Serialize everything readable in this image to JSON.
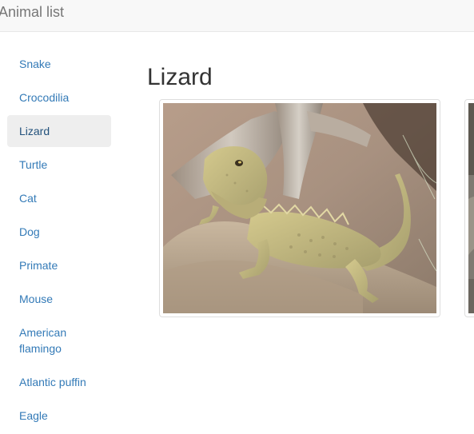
{
  "app": {
    "brand": "Animal list"
  },
  "sidebar": {
    "items": [
      {
        "label": "Snake",
        "active": false
      },
      {
        "label": "Crocodilia",
        "active": false
      },
      {
        "label": "Lizard",
        "active": true
      },
      {
        "label": "Turtle",
        "active": false
      },
      {
        "label": "Cat",
        "active": false
      },
      {
        "label": "Dog",
        "active": false
      },
      {
        "label": "Primate",
        "active": false
      },
      {
        "label": "Mouse",
        "active": false
      },
      {
        "label": "American flamingo",
        "active": false
      },
      {
        "label": "Atlantic puffin",
        "active": false
      },
      {
        "label": "Eagle",
        "active": false
      }
    ]
  },
  "main": {
    "title": "Lizard"
  },
  "colors": {
    "link": "#337ab7",
    "active_link": "#23527c",
    "active_bg": "#eeeeee",
    "navbar_bg": "#f8f8f8",
    "brand_text": "#777777"
  }
}
